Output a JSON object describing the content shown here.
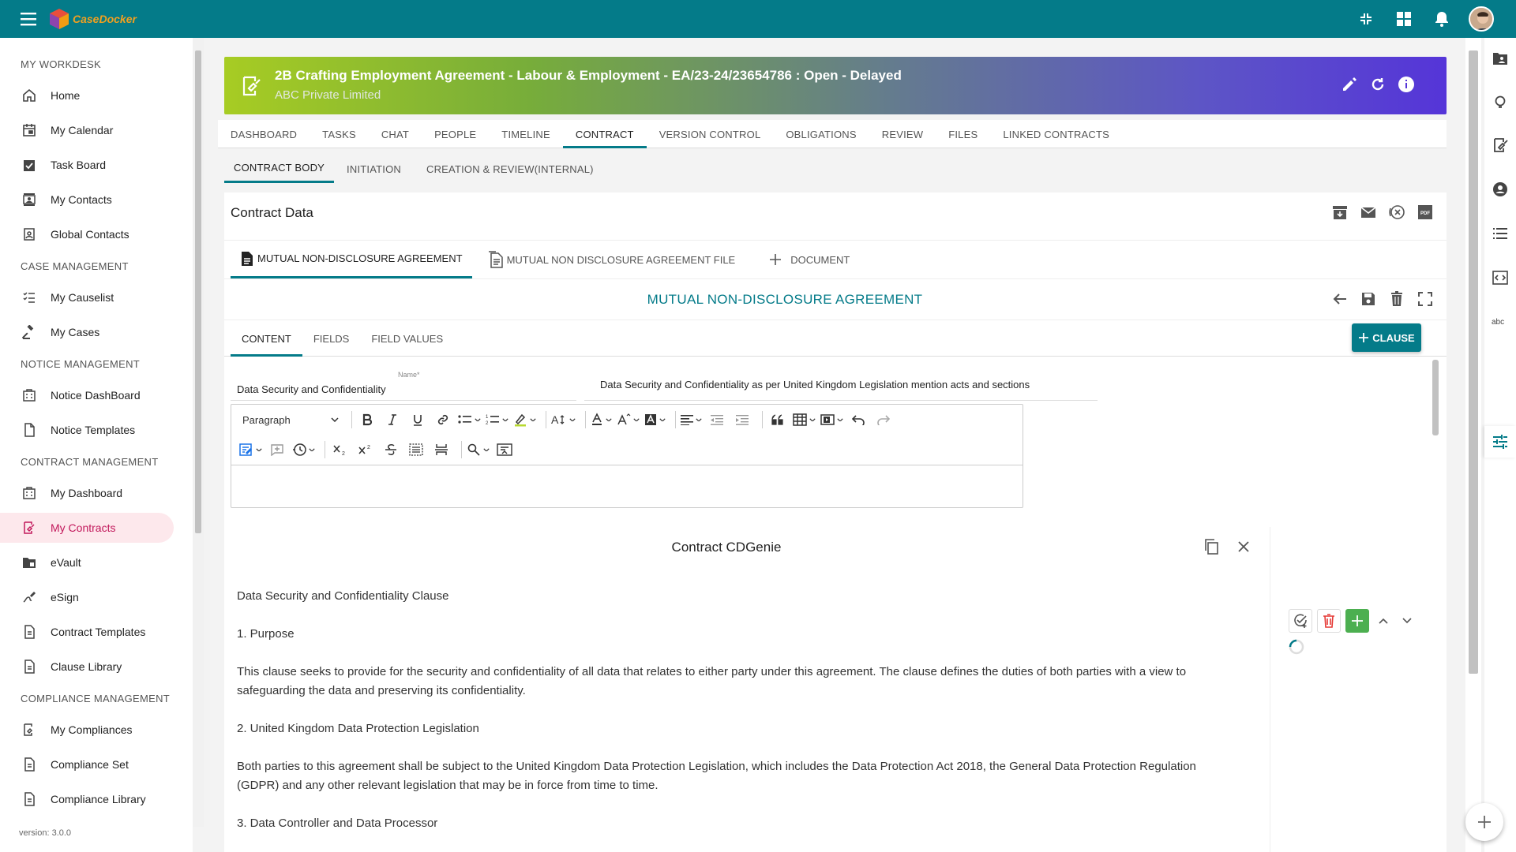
{
  "topbar": {
    "logo_text": "CaseDocker",
    "brand_color": "#047b89"
  },
  "sidebar": {
    "sections": [
      {
        "title": "MY WORKDESK"
      },
      {
        "title": "CASE MANAGEMENT"
      },
      {
        "title": "NOTICE MANAGEMENT"
      },
      {
        "title": "CONTRACT MANAGEMENT"
      },
      {
        "title": "COMPLIANCE MANAGEMENT"
      }
    ],
    "items": [
      {
        "label": "Home",
        "icon": "home-icon"
      },
      {
        "label": "My Calendar",
        "icon": "calendar-icon"
      },
      {
        "label": "Task Board",
        "icon": "task-board-icon"
      },
      {
        "label": "My Contacts",
        "icon": "contacts-icon"
      },
      {
        "label": "Global Contacts",
        "icon": "global-contacts-icon"
      },
      {
        "label": "My Causelist",
        "icon": "causelist-icon"
      },
      {
        "label": "My Cases",
        "icon": "gavel-icon"
      },
      {
        "label": "Notice DashBoard",
        "icon": "notice-dashboard-icon"
      },
      {
        "label": "Notice Templates",
        "icon": "document-icon"
      },
      {
        "label": "My Dashboard",
        "icon": "dashboard-icon"
      },
      {
        "label": "My Contracts",
        "icon": "contract-sign-icon",
        "active": true
      },
      {
        "label": "eVault",
        "icon": "vault-icon"
      },
      {
        "label": "eSign",
        "icon": "esign-icon"
      },
      {
        "label": "Contract Templates",
        "icon": "document-icon"
      },
      {
        "label": "Clause Library",
        "icon": "document-icon"
      },
      {
        "label": "My Compliances",
        "icon": "compliance-icon"
      },
      {
        "label": "Compliance Set",
        "icon": "document-icon"
      },
      {
        "label": "Compliance Library",
        "icon": "document-icon"
      }
    ],
    "version": "version: 3.0.0",
    "active_color": "#c2185b"
  },
  "header": {
    "title": "2B Crafting Employment Agreement - Labour & Employment - EA/23-24/23654786 : Open - Delayed",
    "subtitle": "ABC Private Limited"
  },
  "main_tabs": [
    "DASHBOARD",
    "TASKS",
    "CHAT",
    "PEOPLE",
    "TIMELINE",
    "CONTRACT",
    "VERSION CONTROL",
    "OBLIGATIONS",
    "REVIEW",
    "FILES",
    "LINKED CONTRACTS"
  ],
  "main_tab_active": "CONTRACT",
  "sub_tabs": [
    "CONTRACT BODY",
    "INITIATION",
    "CREATION & REVIEW(INTERNAL)"
  ],
  "card": {
    "title": "Contract Data"
  },
  "doc_tabs": {
    "agreement": "MUTUAL NON-DISCLOSURE AGREEMENT",
    "file": "MUTUAL NON DISCLOSURE AGREEMENT FILE",
    "document": "DOCUMENT"
  },
  "doc_title": "MUTUAL NON-DISCLOSURE AGREEMENT",
  "content_tabs": [
    "CONTENT",
    "FIELDS",
    "FIELD VALUES"
  ],
  "clause_button": "CLAUSE",
  "fields": {
    "name_label": "Name*",
    "name_value": "Data Security and Confidentiality",
    "description_value": "Data Security and Confidentiality  as per United Kingdom Legislation mention acts and sections"
  },
  "editor": {
    "paragraph": "Paragraph"
  },
  "genie": {
    "title": "Contract CDGenie",
    "lines": [
      "Data Security and Confidentiality Clause",
      "1. Purpose",
      "This clause seeks to provide for the security and confidentiality of all data that relates to either party under this agreement. The clause defines the duties of both parties with a view to safeguarding the data and preserving its confidentiality.",
      "2. United Kingdom Data Protection Legislation",
      "Both parties to this agreement shall be subject to the United Kingdom Data Protection Legislation, which includes the Data Protection Act 2018, the General Data Protection Regulation (GDPR) and any other relevant legislation that may be in force from time to time.",
      "3. Data Controller and Data Processor"
    ]
  }
}
